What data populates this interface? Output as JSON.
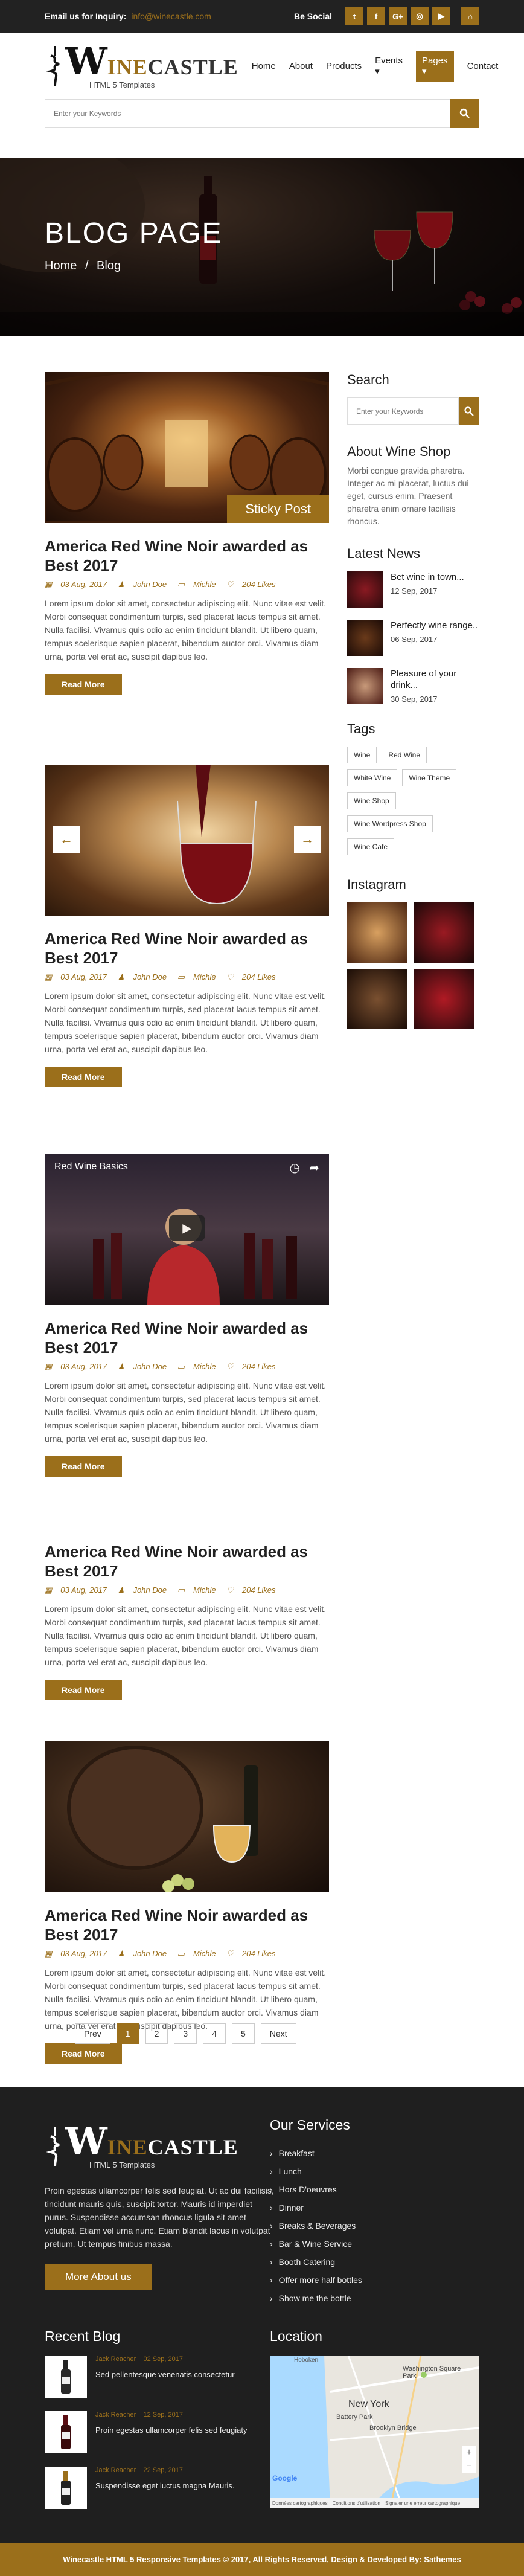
{
  "topbar": {
    "inquiry_label": "Email us for Inquiry:",
    "email": "info@winecastle.com",
    "social_label": "Be Social",
    "social_icons": [
      "twitter-icon",
      "facebook-icon",
      "google-plus-icon",
      "instagram-icon",
      "youtube-icon"
    ]
  },
  "logo": {
    "w": "W",
    "rest_a": "INE",
    "rest_b": "CASTLE",
    "subtitle": "HTML 5 Templates"
  },
  "nav": {
    "items": [
      "Home",
      "About",
      "Products",
      "Events ▾",
      "Pages ▾",
      "Contact"
    ],
    "active": "Pages ▾"
  },
  "search": {
    "placeholder": "Enter your Keywords"
  },
  "hero": {
    "title": "BLOG PAGE",
    "crumb_home": "Home",
    "crumb_sep": "/",
    "crumb_current": "Blog"
  },
  "posts": [
    {
      "badge": "Sticky Post",
      "title": "America Red Wine Noir awarded as Best 2017",
      "date": "03 Aug, 2017",
      "author": "John Doe",
      "category": "Michle",
      "likes": "204 Likes",
      "text": "Lorem ipsum dolor sit amet, consectetur adipiscing elit. Nunc vitae est velit. Morbi consequat condimentum turpis, sed placerat lacus tempus sit amet. Nulla facilisi. Vivamus quis odio ac enim tincidunt blandit. Ut libero quam, tempus scelerisque sapien placerat, bibendum auctor orci. Vivamus diam urna, porta vel erat ac, suscipit dapibus leo.",
      "button": "Read More"
    },
    {
      "title": "America Red Wine Noir awarded as Best 2017",
      "date": "03 Aug, 2017",
      "author": "John Doe",
      "category": "Michle",
      "likes": "204 Likes",
      "text": "Lorem ipsum dolor sit amet, consectetur adipiscing elit. Nunc vitae est velit. Morbi consequat condimentum turpis, sed placerat lacus tempus sit amet. Nulla facilisi. Vivamus quis odio ac enim tincidunt blandit. Ut libero quam, tempus scelerisque sapien placerat, bibendum auctor orci. Vivamus diam urna, porta vel erat ac, suscipit dapibus leo.",
      "button": "Read More"
    },
    {
      "video_title": "Red Wine Basics",
      "title": "America Red Wine Noir awarded as Best 2017",
      "date": "03 Aug, 2017",
      "author": "John Doe",
      "category": "Michle",
      "likes": "204 Likes",
      "text": "Lorem ipsum dolor sit amet, consectetur adipiscing elit. Nunc vitae est velit. Morbi consequat condimentum turpis, sed placerat lacus tempus sit amet. Nulla facilisi. Vivamus quis odio ac enim tincidunt blandit. Ut libero quam, tempus scelerisque sapien placerat, bibendum auctor orci. Vivamus diam urna, porta vel erat ac, suscipit dapibus leo.",
      "button": "Read More"
    },
    {
      "title": "America Red Wine Noir awarded as Best 2017",
      "date": "03 Aug, 2017",
      "author": "John Doe",
      "category": "Michle",
      "likes": "204 Likes",
      "text": "Lorem ipsum dolor sit amet, consectetur adipiscing elit. Nunc vitae est velit. Morbi consequat condimentum turpis, sed placerat lacus tempus sit amet. Nulla facilisi. Vivamus quis odio ac enim tincidunt blandit. Ut libero quam, tempus scelerisque sapien placerat, bibendum auctor orci. Vivamus diam urna, porta vel erat ac, suscipit dapibus leo.",
      "button": "Read More"
    },
    {
      "title": "America Red Wine Noir awarded as Best 2017",
      "date": "03 Aug, 2017",
      "author": "John Doe",
      "category": "Michle",
      "likes": "204 Likes",
      "text": "Lorem ipsum dolor sit amet, consectetur adipiscing elit. Nunc vitae est velit. Morbi consequat condimentum turpis, sed placerat lacus tempus sit amet. Nulla facilisi. Vivamus quis odio ac enim tincidunt blandit. Ut libero quam, tempus scelerisque sapien placerat, bibendum auctor orci. Vivamus diam urna, porta vel erat ac, suscipit dapibus leo.",
      "button": "Read More"
    }
  ],
  "sidebar": {
    "search_title": "Search",
    "search_placeholder": "Enter your Keywords",
    "about_title": "About Wine Shop",
    "about_text": "Morbi congue gravida pharetra. Integer ac mi placerat, luctus dui eget, cursus enim. Praesent pharetra enim ornare facilisis rhoncus.",
    "news_title": "Latest News",
    "news": [
      {
        "title": "Bet wine in town...",
        "date": "12 Sep, 2017"
      },
      {
        "title": "Perfectly wine range..",
        "date": "06 Sep, 2017"
      },
      {
        "title": "Pleasure of your drink...",
        "date": "30 Sep, 2017"
      }
    ],
    "tags_title": "Tags",
    "tags": [
      "Wine",
      "Red Wine",
      "White Wine",
      "Wine Theme",
      "Wine Shop",
      "Wine Wordpress Shop",
      "Wine Cafe"
    ],
    "insta_title": "Instagram"
  },
  "pager": {
    "prev": "Prev",
    "pages": [
      "1",
      "2",
      "3",
      "4",
      "5"
    ],
    "next": "Next",
    "current": "1"
  },
  "footer": {
    "about_text": "Proin egestas ullamcorper felis sed feugiat. Ut ac dui facilisis, tincidunt mauris quis, suscipit tortor. Mauris id imperdiet purus. Suspendisse accumsan rhoncus ligula sit amet volutpat. Etiam vel urna nunc. Etiam blandit lacus in volutpat pretium. Ut tempus finibus massa.",
    "about_button": "More About us",
    "services_title": "Our Services",
    "services": [
      "Breakfast",
      "Lunch",
      "Hors D'oeuvres",
      "Dinner",
      "Breaks & Beverages",
      "Bar & Wine Service",
      "Booth Catering",
      "Offer more half bottles",
      "Show me the bottle"
    ],
    "blog_title": "Recent Blog",
    "blog": [
      {
        "author": "Jack Reacher",
        "date": "02 Sep, 2017",
        "title": "Sed pellentesque venenatis consectetur"
      },
      {
        "author": "Jack Reacher",
        "date": "12 Sep, 2017",
        "title": "Proin egestas ullamcorper felis sed feugiaty"
      },
      {
        "author": "Jack Reacher",
        "date": "22 Sep, 2017",
        "title": "Suspendisse eget luctus magna Mauris."
      }
    ],
    "location_title": "Location",
    "map_labels": [
      "Hoboken",
      "Washington Square Park",
      "New York",
      "Battery Park",
      "Brooklyn Bridge",
      "Google",
      "Données cartographiques",
      "Conditions d'utilisation",
      "Signaler une erreur cartographique"
    ],
    "copyright": "Winecastle HTML 5 Responsive Templates © 2017, All Rights Reserved, Design & Developed By: Sathemes"
  }
}
